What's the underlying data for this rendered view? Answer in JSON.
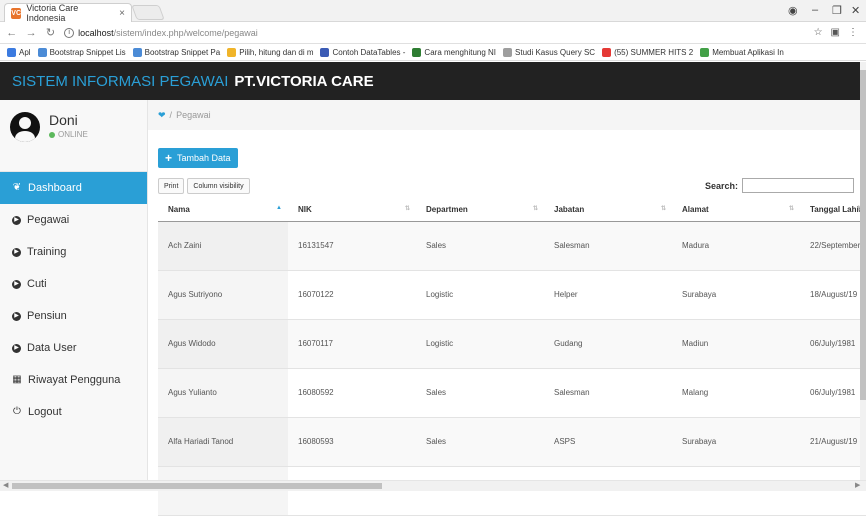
{
  "browser": {
    "tab_title": "Victoria Care Indonesia",
    "tab_close": "×",
    "url_host": "localhost",
    "url_path": "/sistem/index.php/welcome/pegawai",
    "bookmarks": [
      {
        "label": "Apl",
        "color": "#3c7be0"
      },
      {
        "label": "Bootstrap Snippet Lis",
        "color": "#4b8bd6"
      },
      {
        "label": "Bootstrap Snippet Pa",
        "color": "#4b8bd6"
      },
      {
        "label": "Pilih, hitung dan di m",
        "color": "#f0b429"
      },
      {
        "label": "Contoh DataTables -",
        "color": "#3b5bb5"
      },
      {
        "label": "Cara menghitung NI",
        "color": "#2e7d32"
      },
      {
        "label": "Studi Kasus Query SC",
        "color": "#9e9e9e"
      },
      {
        "label": "(55) SUMMER HITS 2",
        "color": "#e53935"
      },
      {
        "label": "Membuat Aplikasi In",
        "color": "#43a047"
      }
    ]
  },
  "header": {
    "brand_a": "SISTEM INFORMASI PEGAWAI",
    "brand_b": "PT.VICTORIA CARE"
  },
  "user": {
    "name": "Doni",
    "status": "ONLINE"
  },
  "sidebar": {
    "items": [
      {
        "label": "Dashboard",
        "icon": "home-icon",
        "active": true
      },
      {
        "label": "Pegawai",
        "icon": "circle-arrow-icon"
      },
      {
        "label": "Training",
        "icon": "circle-arrow-icon"
      },
      {
        "label": "Cuti",
        "icon": "circle-arrow-icon"
      },
      {
        "label": "Pensiun",
        "icon": "circle-arrow-icon"
      },
      {
        "label": "Data User",
        "icon": "circle-arrow-icon"
      },
      {
        "label": "Riwayat Pengguna",
        "icon": "calendar-icon"
      },
      {
        "label": "Logout",
        "icon": "power-icon"
      }
    ]
  },
  "breadcrumb": {
    "current": "Pegawai"
  },
  "buttons": {
    "add": "Tambah Data",
    "print": "Print",
    "colvis": "Column visibility"
  },
  "search": {
    "label": "Search:",
    "value": ""
  },
  "table": {
    "columns": [
      "Nama",
      "NIK",
      "Departmen",
      "Jabatan",
      "Alamat",
      "Tanggal Lahir"
    ],
    "rows": [
      [
        "Ach Zaini",
        "16131547",
        "Sales",
        "Salesman",
        "Madura",
        "22/September"
      ],
      [
        "Agus Sutriyono",
        "16070122",
        "Logistic",
        "Helper",
        "Surabaya",
        "18/August/19"
      ],
      [
        "Agus Widodo",
        "16070117",
        "Logistic",
        "Gudang",
        "Madiun",
        "06/July/1981"
      ],
      [
        "Agus Yulianto",
        "16080592",
        "Sales",
        "Salesman",
        "Malang",
        "06/July/1981"
      ],
      [
        "Alfa Hariadi Tanod",
        "16080593",
        "Sales",
        "ASPS",
        "Surabaya",
        "21/August/19"
      ],
      [
        "",
        "",
        "",
        "",
        "",
        ""
      ]
    ]
  }
}
